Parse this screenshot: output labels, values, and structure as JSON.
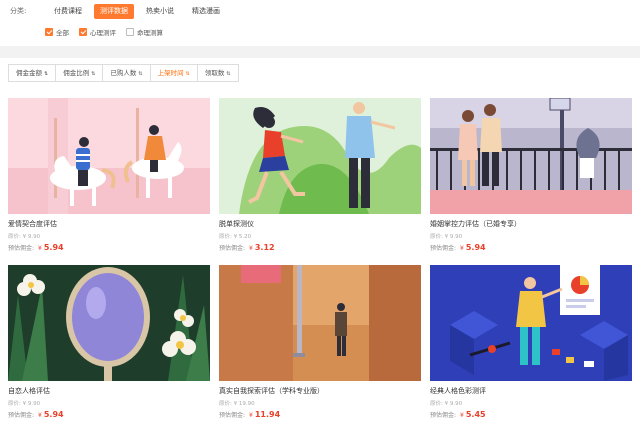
{
  "nav": {
    "category_label": "分类:",
    "tabs": [
      {
        "label": "付费课程",
        "active": false
      },
      {
        "label": "测评数据",
        "active": true
      },
      {
        "label": "热卖小说",
        "active": false
      },
      {
        "label": "精选漫画",
        "active": false
      }
    ]
  },
  "filters": [
    {
      "label": "全部",
      "checked": true
    },
    {
      "label": "心理测评",
      "checked": true
    },
    {
      "label": "命理测算",
      "checked": false
    }
  ],
  "sort": [
    {
      "label": "佣金金额",
      "arrow": "⇅",
      "active": false
    },
    {
      "label": "佣金比例",
      "arrow": "⇅",
      "active": false
    },
    {
      "label": "已购人数",
      "arrow": "⇅",
      "active": false
    },
    {
      "label": "上架时间",
      "arrow": "⇅",
      "active": true
    },
    {
      "label": "领取数",
      "arrow": "⇅",
      "active": false
    }
  ],
  "products": [
    {
      "title": "爱情契合度评估",
      "orig_label": "原价:",
      "orig_price": "¥ 9.90",
      "comm_label": "预估佣金:",
      "currency": "¥",
      "commission": "5.94"
    },
    {
      "title": "脱单探测仪",
      "orig_label": "原价:",
      "orig_price": "¥ 5.20",
      "comm_label": "预估佣金:",
      "currency": "¥",
      "commission": "3.12"
    },
    {
      "title": "婚姻掌控力评估（已婚专享）",
      "orig_label": "原价:",
      "orig_price": "¥ 9.90",
      "comm_label": "预估佣金:",
      "currency": "¥",
      "commission": "5.94"
    },
    {
      "title": "自恋人格评估",
      "orig_label": "原价:",
      "orig_price": "¥ 9.90",
      "comm_label": "预估佣金:",
      "currency": "¥",
      "commission": "5.94"
    },
    {
      "title": "真实自我探索评估（学科专业版）",
      "orig_label": "原价:",
      "orig_price": "¥ 19.90",
      "comm_label": "预估佣金:",
      "currency": "¥",
      "commission": "11.94"
    },
    {
      "title": "经典人格色彩测评",
      "orig_label": "原价:",
      "orig_price": "¥ 9.90",
      "comm_label": "预估佣金:",
      "currency": "¥",
      "commission": "5.45"
    }
  ],
  "colors": {
    "accent": "#ff7a2e",
    "price": "#e8402a"
  }
}
